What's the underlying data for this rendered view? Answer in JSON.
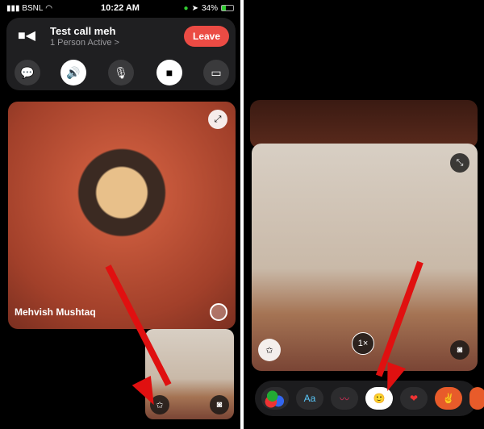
{
  "status_bar": {
    "carrier": "BSNL",
    "time": "10:22 AM",
    "battery": "34%"
  },
  "call": {
    "title": "Test call meh",
    "subtitle": "1 Person Active >",
    "leave_label": "Leave"
  },
  "participant": {
    "name": "Mehvish Mushtaq"
  },
  "camera": {
    "zoom_label": "1×"
  },
  "effects": {
    "text_label": "Aa"
  },
  "colors": {
    "leave": "#eb4b44",
    "arrow": "#e01010"
  }
}
